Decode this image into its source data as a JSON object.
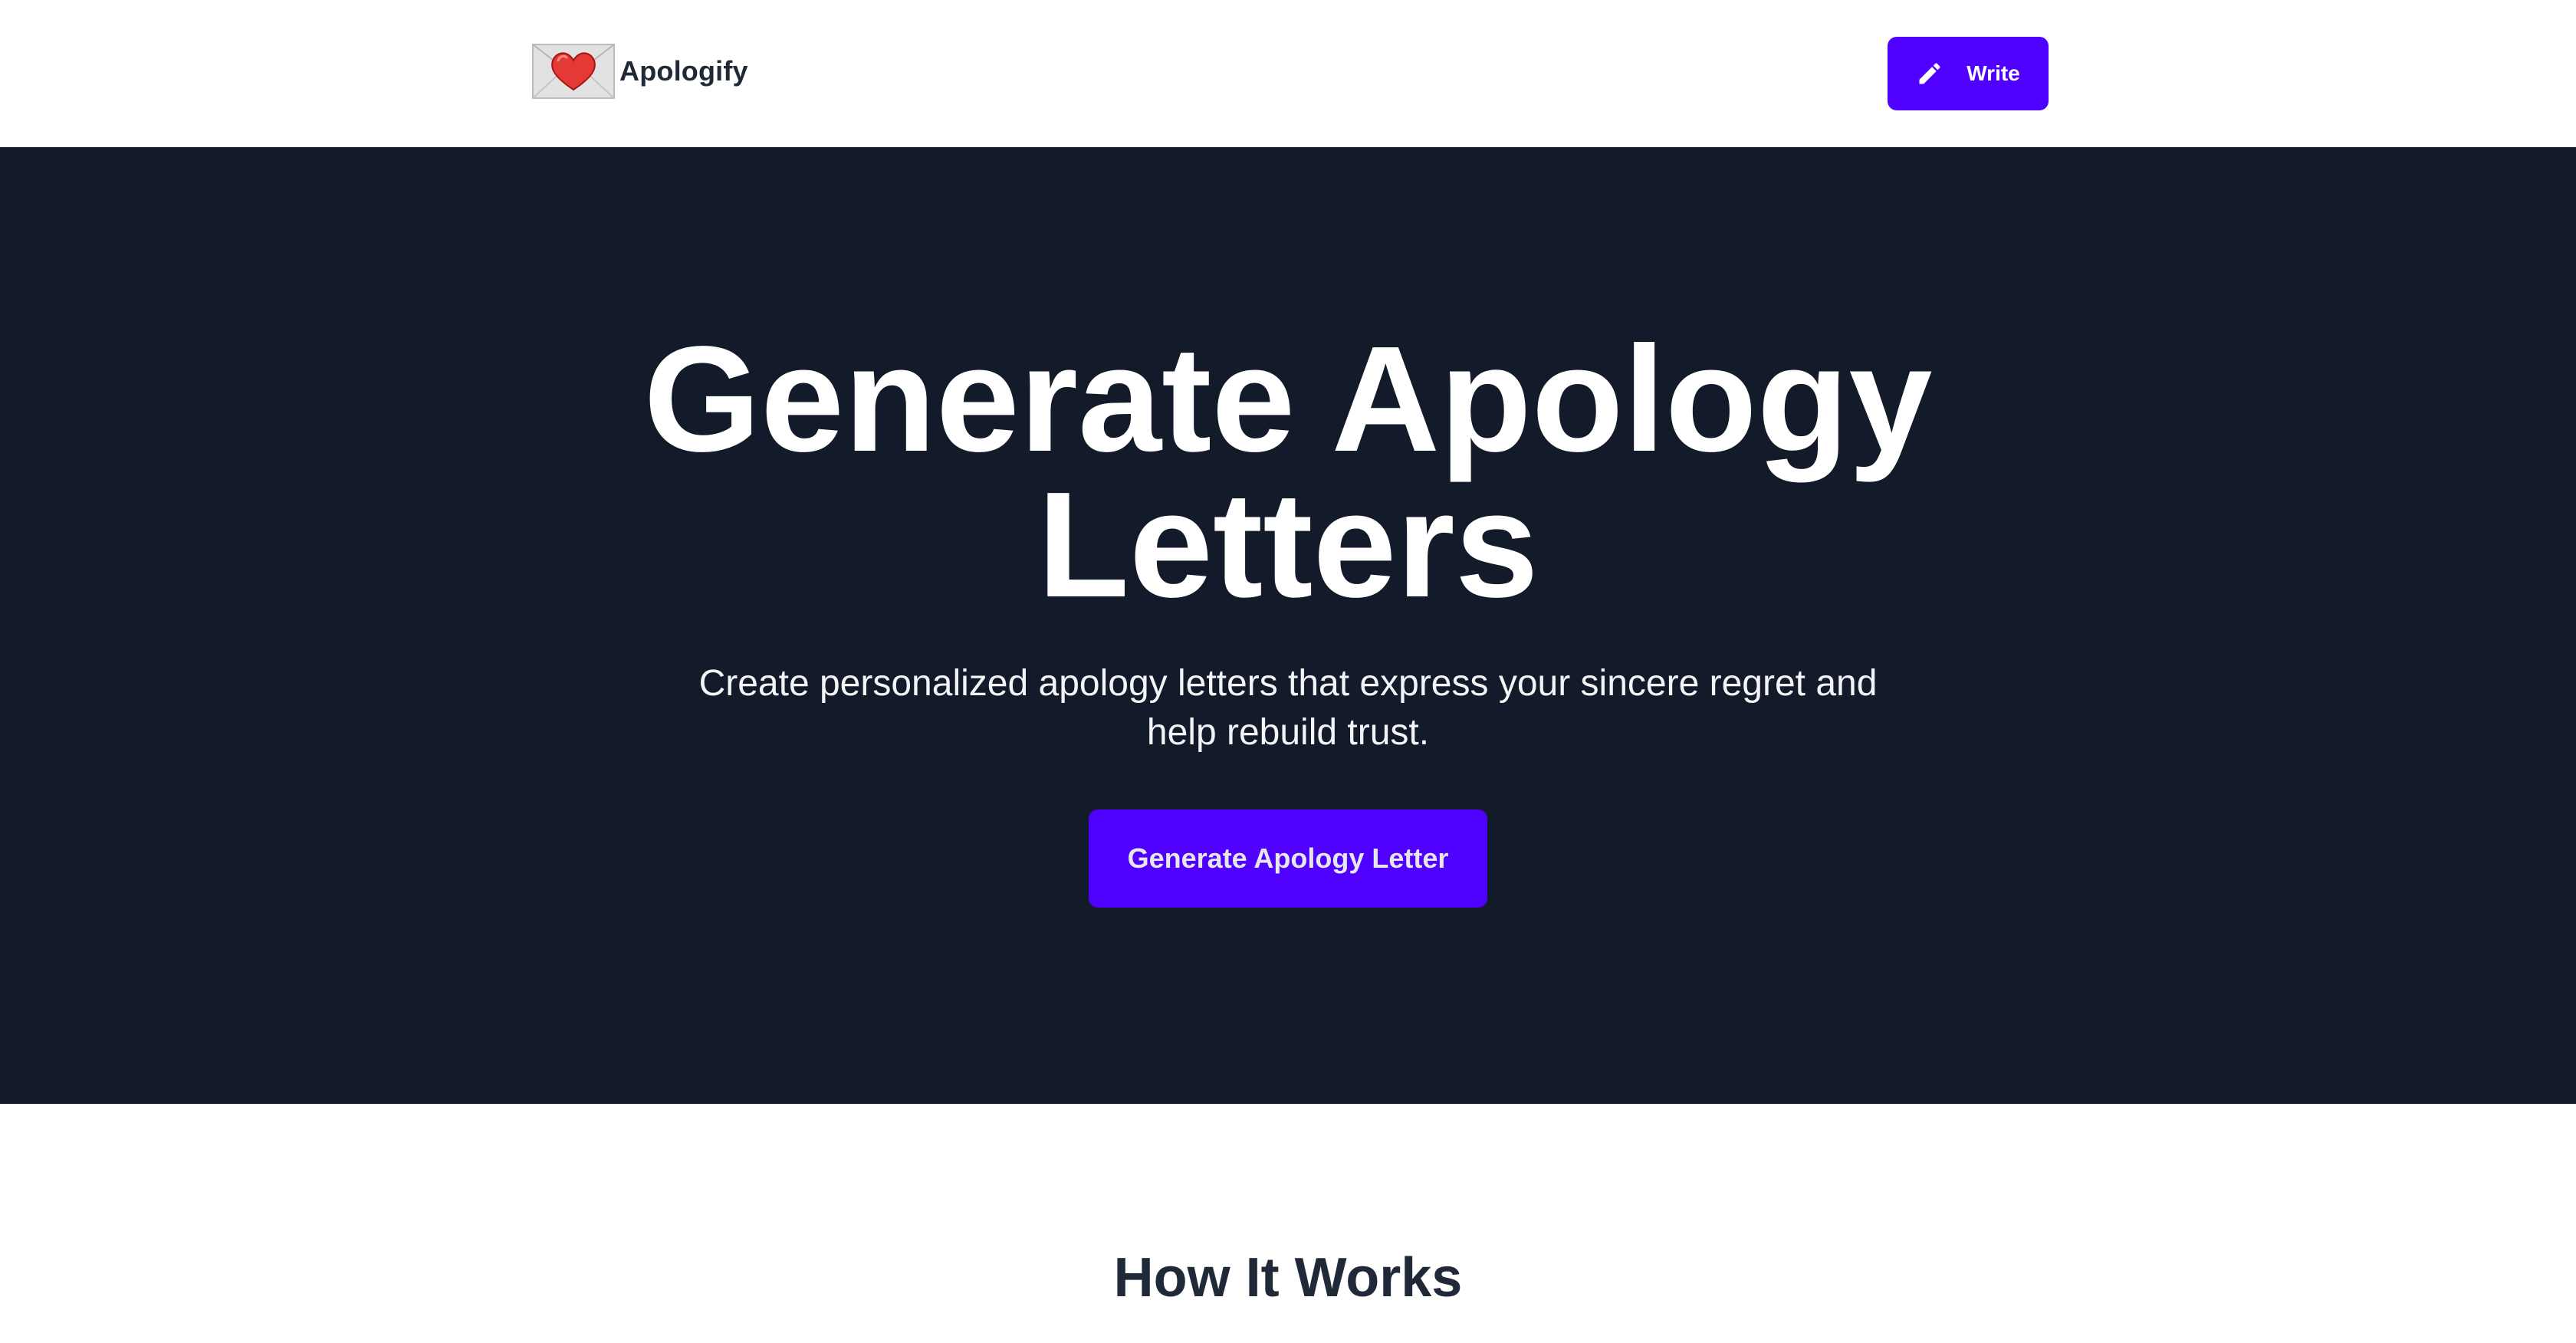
{
  "header": {
    "brand_name": "Apologify",
    "logo_icon": "love-letter-icon",
    "write_button_label": "Write",
    "write_button_icon": "pencil-icon"
  },
  "hero": {
    "title_line1": "Generate Apology",
    "title_line2": "Letters",
    "subtitle": "Create personalized apology letters that express your sincere regret and help rebuild trust.",
    "cta_label": "Generate Apology Letter"
  },
  "how_it_works": {
    "title": "How It Works"
  },
  "colors": {
    "accent": "#4f00ff",
    "hero_background": "#131a2a",
    "heading_text": "#1f2937",
    "heart": "#e53935"
  }
}
